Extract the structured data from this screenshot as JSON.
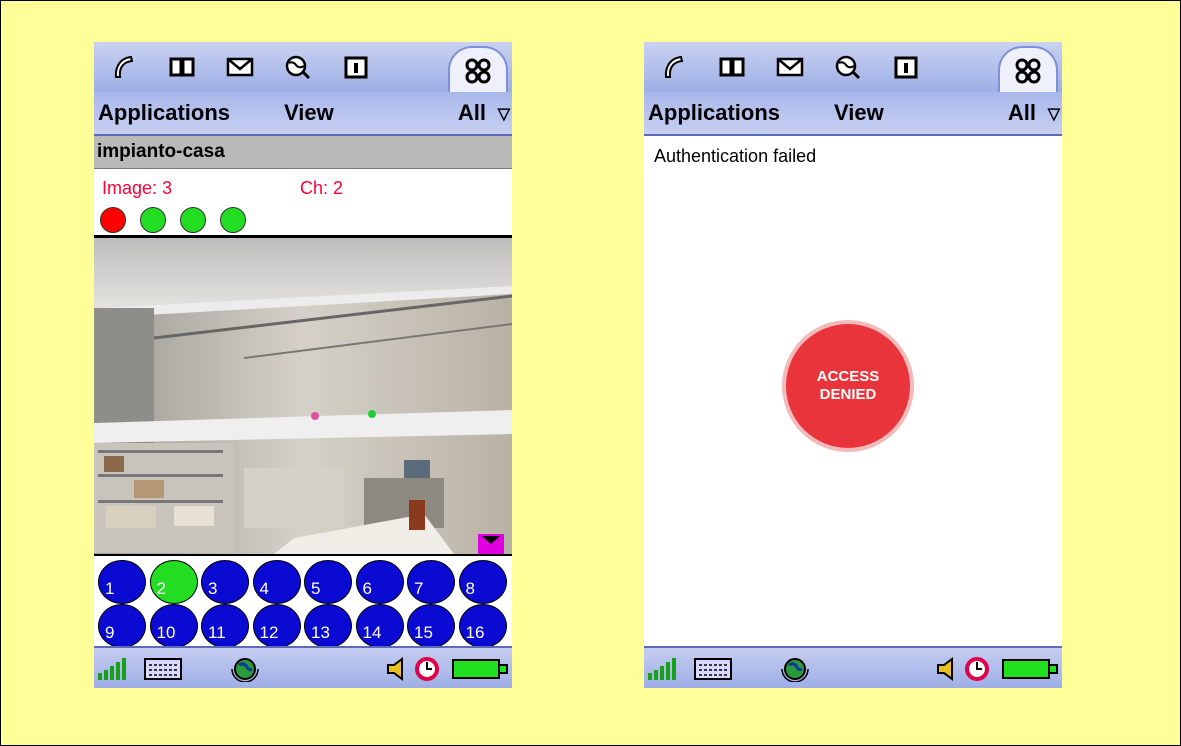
{
  "left_phone": {
    "menu": {
      "applications": "Applications",
      "view": "View",
      "all": "All"
    },
    "title": "impianto-casa",
    "image_label": "Image: 3",
    "channel_label": "Ch: 2",
    "indicators": [
      "#ff0000",
      "#22dd22",
      "#22dd22",
      "#22dd22"
    ],
    "channels": [
      "1",
      "2",
      "3",
      "4",
      "5",
      "6",
      "7",
      "8",
      "9",
      "10",
      "11",
      "12",
      "13",
      "14",
      "15",
      "16"
    ],
    "active_channel": "2"
  },
  "right_phone": {
    "menu": {
      "applications": "Applications",
      "view": "View",
      "all": "All"
    },
    "message": "Authentication failed",
    "stamp_line1": "ACCESS",
    "stamp_line2": "DENIED"
  },
  "icons": {
    "top": [
      "phone-icon",
      "contacts-book-icon",
      "messaging-envelope-icon",
      "web-browser-icon",
      "calendar-icon",
      "applications-grid-icon"
    ],
    "bottom": [
      "signal-strength-icon",
      "keyboard-icon",
      "globe-connection-icon",
      "speaker-icon",
      "clock-icon",
      "battery-icon"
    ]
  },
  "colors": {
    "background": "#ffff99",
    "channel_button": "#0a0ad2",
    "channel_active": "#22dd22",
    "status_red": "#ff0033",
    "denied_red": "#e8343a"
  }
}
